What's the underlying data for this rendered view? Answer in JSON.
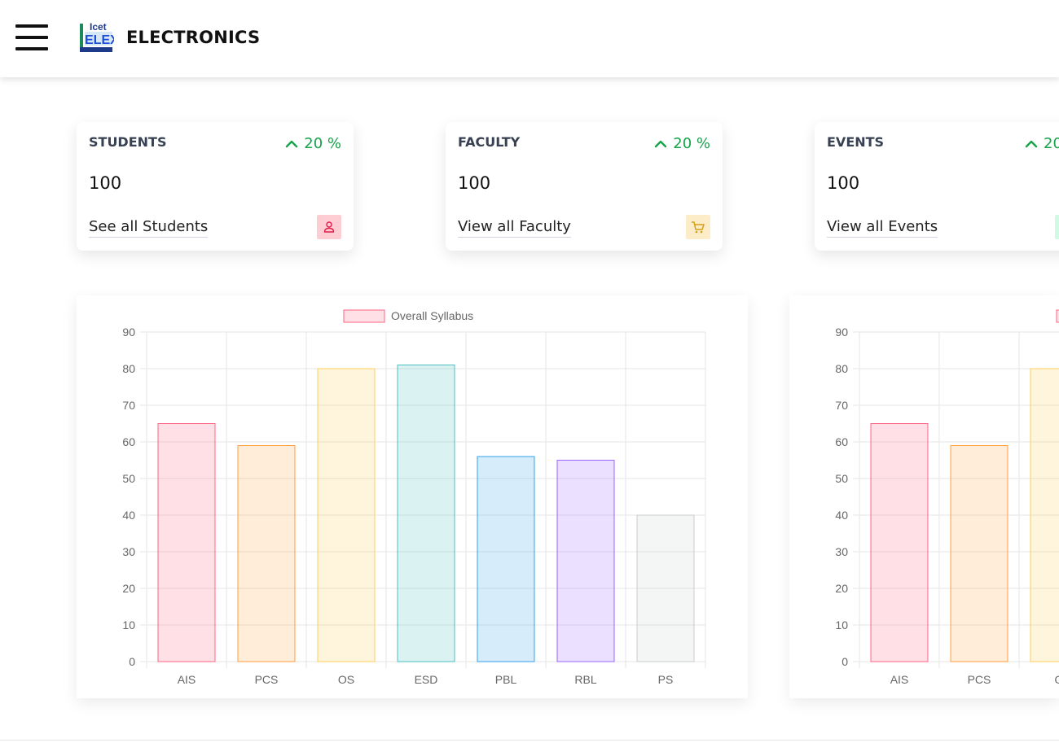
{
  "header": {
    "title": "ELECTRONICS",
    "logo_text": "Icet ELEX ENGINEERS"
  },
  "cards": [
    {
      "title": "STUDENTS",
      "trend": "20 %",
      "value": "100",
      "link": "See all Students",
      "icon": "user-icon",
      "badge_bg": "#fecdd3",
      "icon_color": "#e11d48"
    },
    {
      "title": "FACULTY",
      "trend": "20 %",
      "value": "100",
      "link": "View all Faculty",
      "icon": "cart-icon",
      "badge_bg": "#fdecc8",
      "icon_color": "#d4a017"
    },
    {
      "title": "EVENTS",
      "trend": "20",
      "value": "100",
      "link": "View all Events",
      "icon": "calendar-icon",
      "badge_bg": "#d1fae5",
      "icon_color": "#16a34a"
    }
  ],
  "colors": {
    "trend": "#16a34a"
  },
  "chart_data": [
    {
      "type": "bar",
      "legend": "Overall Syllabus",
      "categories": [
        "AIS",
        "PCS",
        "OS",
        "ESD",
        "PBL",
        "RBL",
        "PS"
      ],
      "values": [
        65,
        59,
        80,
        81,
        56,
        55,
        40
      ],
      "ylim": [
        0,
        90
      ],
      "yticks": [
        0,
        10,
        20,
        30,
        40,
        50,
        60,
        70,
        80,
        90
      ],
      "grid": true,
      "legend_position": "top",
      "colors": [
        "#ff6384",
        "#ff9f40",
        "#ffcd56",
        "#4bc0c0",
        "#36a2eb",
        "#9966ff",
        "#c9cbcf"
      ]
    },
    {
      "type": "bar",
      "categories": [
        "AIS",
        "PCS",
        "O"
      ],
      "values": [
        65,
        59,
        80
      ],
      "ylim": [
        0,
        90
      ],
      "yticks": [
        0,
        10,
        20,
        30,
        40,
        50,
        60,
        70,
        80,
        90
      ],
      "grid": true,
      "legend_position": "top",
      "colors": [
        "#ff6384",
        "#ff9f40",
        "#ffcd56"
      ]
    }
  ]
}
